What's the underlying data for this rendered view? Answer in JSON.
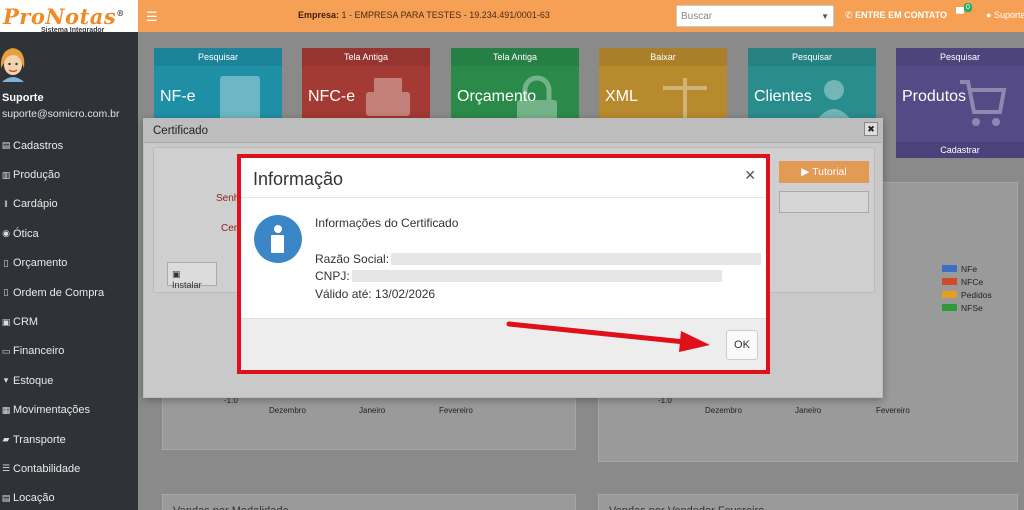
{
  "brand": {
    "name": "ProNotas",
    "reg": "®",
    "tagline": "Sistema Integrador"
  },
  "sidebar": {
    "user_name": "Suporte",
    "user_email": "suporte@somicro.com.br",
    "items": [
      {
        "label": "Cadastros",
        "icon": "file-icon"
      },
      {
        "label": "Produção",
        "icon": "bar-chart-icon"
      },
      {
        "label": "Cardápio",
        "icon": "cutlery-icon"
      },
      {
        "label": "Ótica",
        "icon": "eye-icon"
      },
      {
        "label": "Orçamento",
        "icon": "document-icon"
      },
      {
        "label": "Ordem de Compra",
        "icon": "document-icon"
      },
      {
        "label": "CRM",
        "icon": "clipboard-icon"
      },
      {
        "label": "Financeiro",
        "icon": "money-icon"
      },
      {
        "label": "Estoque",
        "icon": "cart-icon"
      },
      {
        "label": "Movimentações",
        "icon": "table-icon"
      },
      {
        "label": "Transporte",
        "icon": "truck-icon"
      },
      {
        "label": "Contabilidade",
        "icon": "list-icon"
      },
      {
        "label": "Locação",
        "icon": "briefcase-icon"
      }
    ]
  },
  "topbar": {
    "empresa_label": "Empresa:",
    "empresa_value": "1 - EMPRESA PARA TESTES - 19.234.491/0001-63",
    "search_placeholder": "Buscar",
    "contact_label": "ENTRE EM CONTATO",
    "notif_count": "0",
    "user_label": "Suporte"
  },
  "tiles": [
    {
      "header": "Pesquisar",
      "title": "NF-e",
      "footer": "",
      "color": "#1f8fa5"
    },
    {
      "header": "Tela Antiga",
      "title": "NFC-e",
      "footer": "",
      "color": "#a33a33"
    },
    {
      "header": "Tela Antiga",
      "title": "Orçamento",
      "footer": "",
      "color": "#2a8a4a"
    },
    {
      "header": "Baixar",
      "title": "XML",
      "footer": "",
      "color": "#b88a2e"
    },
    {
      "header": "Pesquisar",
      "title": "Clientes",
      "footer": "",
      "color": "#2a8d8d"
    },
    {
      "header": "Pesquisar",
      "title": "Produtos",
      "footer": "Cadastrar",
      "color": "#534a86"
    }
  ],
  "chart_left": {
    "ytick": "-1.0",
    "xticks": [
      "Dezembro",
      "Janeiro",
      "Fevereiro"
    ]
  },
  "chart_right": {
    "ytick": "-1.0",
    "xticks": [
      "Dezembro",
      "Janeiro",
      "Fevereiro"
    ],
    "legend": [
      {
        "label": "NFe",
        "color": "#3f6fc4"
      },
      {
        "label": "NFCe",
        "color": "#d04a2a"
      },
      {
        "label": "Pedidos",
        "color": "#e3a020"
      },
      {
        "label": "NFSe",
        "color": "#2e9a3a"
      }
    ]
  },
  "bottom_panels": [
    "Vendas por Modalidade",
    "Vendas por Vendedor Fevereiro"
  ],
  "cert_modal": {
    "title": "Certificado",
    "label_senha": "Senha",
    "label_cert": "Certi",
    "tutorial_label": "Tutorial",
    "install_label": "Instalar"
  },
  "info_dialog": {
    "title": "Informação",
    "subtitle": "Informações do Certificado",
    "razao_label": "Razão Social:",
    "cnpj_label": "CNPJ:",
    "validade_label": "Válido até: 13/02/2026",
    "ok_label": "OK"
  },
  "annotation": {
    "frame_color": "#e0101a"
  }
}
